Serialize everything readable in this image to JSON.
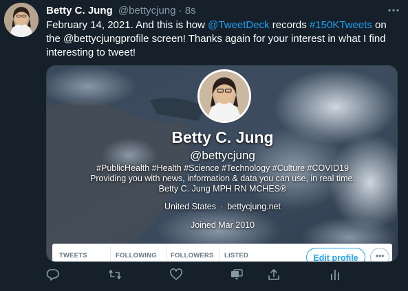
{
  "tweet": {
    "author_name": "Betty C. Jung",
    "author_handle": "@bettycjung",
    "separator": "·",
    "time": "8s",
    "text_part1": "February 14, 2021. And this is how ",
    "mention_tweetdeck": "@TweetDeck",
    "text_part2": " records ",
    "hashtag": "#150KTweets",
    "text_part3": " on the @bettycjungprofile screen! Thanks again for your interest in what I find interesting to tweet!"
  },
  "media": {
    "profile_name": "Betty C. Jung",
    "profile_handle": "@bettycjung",
    "bio_line1": "#PublicHealth #Health #Science #Technology #Culture #COVID19",
    "bio_line2": "Providing you with news, information & data you can use, in real time.",
    "bio_line3": "Betty C. Jung MPH RN MCHES®",
    "location": "United States",
    "meta_separator": "·",
    "website": "bettycjung.net",
    "joined": "Joined Mar 2010",
    "stats": [
      "TWEETS",
      "FOLLOWING",
      "FOLLOWERS",
      "LISTED"
    ],
    "edit_profile_label": "Edit profile",
    "more_label": "•••"
  },
  "icons": {
    "reply": "reply-icon",
    "retweet": "retweet-icon",
    "like": "heart-icon",
    "tweetdeck": "tweetdeck-icon",
    "share": "share-icon",
    "analytics": "analytics-icon",
    "more": "more-icon"
  },
  "colors": {
    "background": "#15202b",
    "accent": "#1da1f2",
    "secondary_text": "#8899a6"
  }
}
